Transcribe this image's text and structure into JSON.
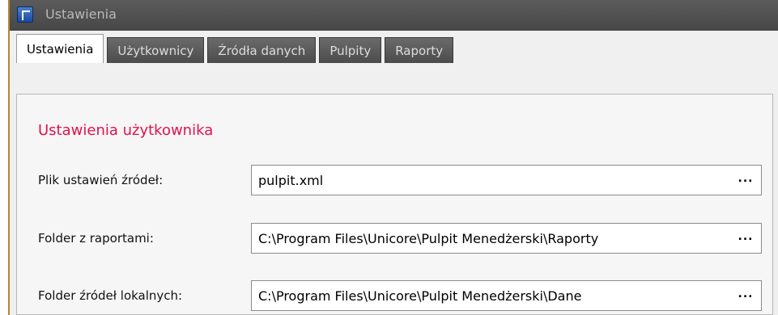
{
  "window": {
    "title": "Ustawienia"
  },
  "tabs": [
    {
      "label": "Ustawienia",
      "active": true
    },
    {
      "label": "Użytkownicy",
      "active": false
    },
    {
      "label": "Źródła danych",
      "active": false
    },
    {
      "label": "Pulpity",
      "active": false
    },
    {
      "label": "Raporty",
      "active": false
    }
  ],
  "section": {
    "title": "Ustawienia użytkownika"
  },
  "fields": [
    {
      "label": "Plik ustawień źródeł:",
      "value": "pulpit.xml",
      "button": "..."
    },
    {
      "label": "Folder z raportami:",
      "value": "C:\\Program Files\\Unicore\\Pulpit Menedżerski\\Raporty",
      "button": "..."
    },
    {
      "label": "Folder źródeł lokalnych:",
      "value": "C:\\Program Files\\Unicore\\Pulpit Menedżerski\\Dane",
      "button": "..."
    }
  ],
  "colors": {
    "section_title": "#e0124a",
    "titlebar": "#4f4f4f",
    "tab_inactive": "#5a5a5a"
  }
}
